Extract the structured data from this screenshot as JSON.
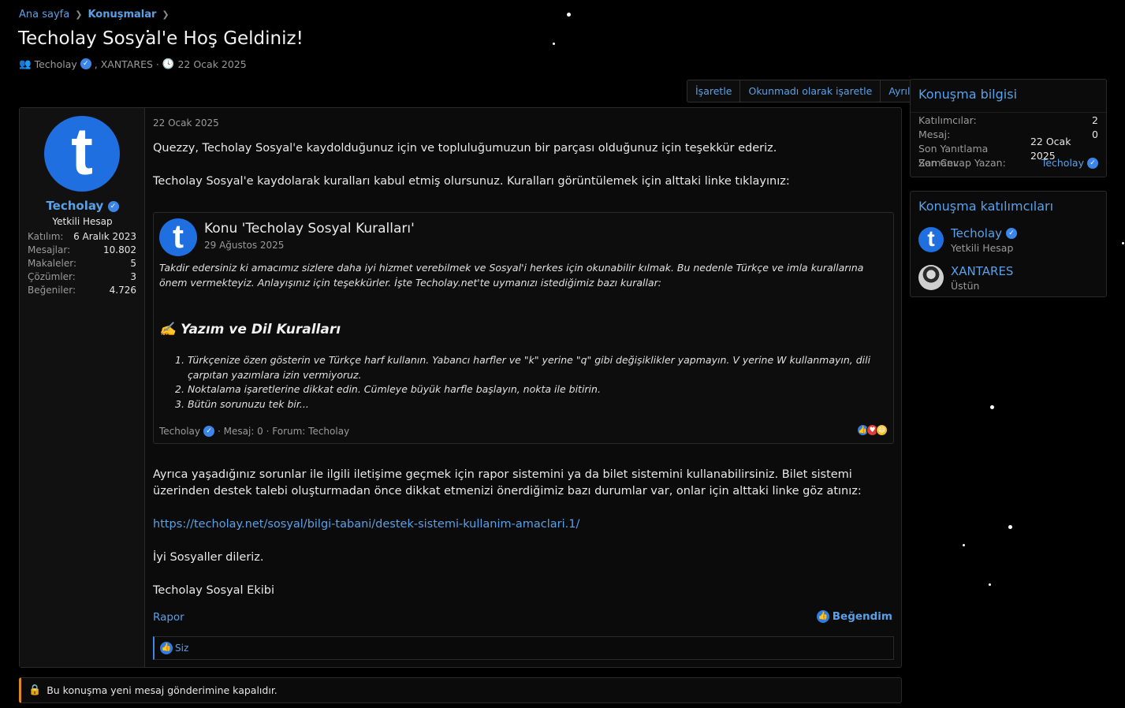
{
  "breadcrumb": {
    "home": "Ana sayfa",
    "section": "Konuşmalar"
  },
  "thread": {
    "title": "Techolay Sosyal'e Hoş Geldiniz!",
    "starter": "Techolay",
    "participant2": ", XANTARES ·",
    "date": "22 Ocak 2025"
  },
  "actions": {
    "mark": "İşaretle",
    "mark_unread": "Okunmadı olarak işaretle",
    "leave": "Ayrıl"
  },
  "post": {
    "user": {
      "avatar_letter": "t",
      "name": "Techolay",
      "title": "Yetkili Hesap",
      "stats": [
        {
          "k": "Katılım:",
          "v": "6 Aralık 2023"
        },
        {
          "k": "Mesajlar:",
          "v": "10.802"
        },
        {
          "k": "Makaleler:",
          "v": "5"
        },
        {
          "k": "Çözümler:",
          "v": "3"
        },
        {
          "k": "Beğeniler:",
          "v": "4.726"
        }
      ]
    },
    "date": "22 Ocak 2025",
    "p1": "Quezzy, Techolay Sosyal'e kaydolduğunuz için ve topluluğumuzun bir parçası olduğunuz için teşekkür ederiz.",
    "p2": "Techolay Sosyal'e kaydolarak kuralları kabul etmiş olursunuz. Kuralları görüntülemek için alttaki linke tıklayınız:",
    "quote": {
      "avatar_letter": "t",
      "title": "Konu 'Techolay Sosyal Kuralları'",
      "date": "29 Ağustos 2025",
      "intro": "Takdir edersiniz ki amacımız sizlere daha iyi hizmet verebilmek ve Sosyal'i herkes için okunabilir kılmak. Bu nedenle Türkçe ve imla kurallarına önem vermekteyiz. Anlayışınız için teşekkürler. İşte Techolay.net'te uymanızı istediğimiz bazı kurallar:",
      "heading_icon": "✍️",
      "heading": "Yazım ve Dil Kuralları",
      "items": [
        {
          "n": "1.",
          "t": "Türkçenize özen gösterin ve Türkçe harf kullanın. Yabancı harfler ve \"k\" yerine \"q\" gibi değişiklikler yapmayın. V yerine W kullanmayın, dili çarpıtan yazımlara izin vermiyoruz."
        },
        {
          "n": "2.",
          "t": "Noktalama işaretlerine dikkat edin. Cümleye büyük harfle başlayın, nokta ile bitirin."
        },
        {
          "n": "3.",
          "t": "Bütün sorunuzu tek bir..."
        }
      ],
      "footer_user": "Techolay",
      "footer_rest": "· Mesaj: 0 · Forum: Techolay"
    },
    "p3": "Ayrıca yaşadığınız sorunlar ile ilgili iletişime geçmek için rapor sistemini ya da bilet sistemini kullanabilirsiniz. Bilet sistemi üzerinden destek talebi oluşturmadan önce dikkat etmenizi önerdiğimiz bazı durumlar var, onlar için alttaki linke göz atınız:",
    "link": "https://techolay.net/sosyal/bilgi-tabani/destek-sistemi-kullanim-amaclari.1/",
    "p4": "İyi Sosyaller dileriz.",
    "p5": "Techolay Sosyal Ekibi",
    "report": "Rapor",
    "like": "Beğendim",
    "reactors": "Siz"
  },
  "locked_notice": "Bu konuşma yeni mesaj gönderimine kapalıdır.",
  "info_box": {
    "title": "Konuşma bilgisi",
    "rows": [
      {
        "k": "Katılımcılar:",
        "v": "2"
      },
      {
        "k": "Mesaj:",
        "v": "0"
      },
      {
        "k": "Son Yanıtlama Zamanı:",
        "v": "22 Ocak 2025"
      },
      {
        "k": "Son Cevap Yazan:",
        "v": "Techolay"
      }
    ]
  },
  "participants_box": {
    "title": "Konuşma katılımcıları",
    "list": [
      {
        "avatar_letter": "t",
        "name": "Techolay",
        "role": "Yetkili Hesap"
      },
      {
        "name": "XANTARES",
        "role": "Üstün"
      }
    ]
  },
  "colors": {
    "accent": "#5aa0e6",
    "brand": "#1f6fe0",
    "warning": "#d68a1f",
    "background": "#000000"
  }
}
